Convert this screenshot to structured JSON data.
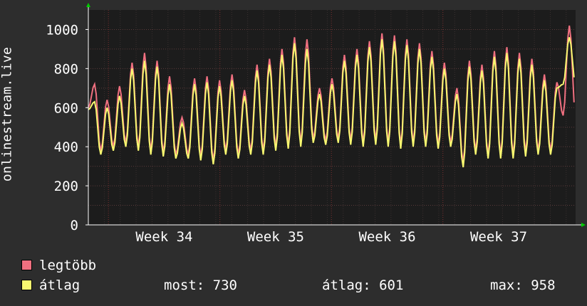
{
  "chart_data": {
    "type": "line",
    "ylabel": "onlinestream.live",
    "ylim": [
      0,
      1100
    ],
    "yticks": [
      0,
      200,
      400,
      600,
      800,
      1000
    ],
    "xlim": [
      0,
      4.37
    ],
    "x_tick_labels": [
      "Week 34",
      "Week 35",
      "Week 36",
      "Week 37"
    ],
    "x_tick_positions": [
      0.68,
      1.68,
      2.68,
      3.68
    ],
    "grid": true,
    "colors": {
      "background": "#2d2d2d",
      "plot_background": "#1c1c1c",
      "grid": "#5a3a3a",
      "axis": "#ffffff",
      "arrow": "#00cc00",
      "max_series": "#f07080",
      "avg_series": "#f8f870"
    },
    "series": [
      {
        "name": "legtöbb",
        "color": "#f07080",
        "daily_peaks": [
          720,
          640,
          710,
          830,
          880,
          840,
          760,
          550,
          750,
          760,
          740,
          770,
          690,
          820,
          850,
          900,
          960,
          950,
          700,
          750,
          870,
          900,
          940,
          980,
          970,
          950,
          930,
          890,
          830,
          700,
          840,
          820,
          890,
          910,
          880,
          850,
          770,
          730,
          1020
        ],
        "daily_troughs": [
          600,
          380,
          400,
          420,
          400,
          380,
          370,
          360,
          360,
          350,
          330,
          380,
          360,
          380,
          380,
          400,
          410,
          420,
          440,
          430,
          440,
          430,
          420,
          430,
          420,
          410,
          420,
          420,
          410,
          420,
          320,
          380,
          360,
          360,
          360,
          370,
          380,
          380,
          560
        ]
      },
      {
        "name": "átlag",
        "color": "#f8f870",
        "daily_peaks": [
          630,
          600,
          660,
          800,
          840,
          810,
          720,
          520,
          720,
          730,
          710,
          740,
          660,
          790,
          820,
          870,
          930,
          900,
          670,
          720,
          840,
          870,
          910,
          950,
          940,
          920,
          900,
          860,
          800,
          670,
          810,
          790,
          860,
          880,
          850,
          820,
          740,
          700,
          960
        ],
        "daily_troughs": [
          590,
          360,
          380,
          400,
          380,
          360,
          350,
          340,
          340,
          330,
          310,
          360,
          340,
          360,
          360,
          380,
          390,
          400,
          420,
          410,
          420,
          410,
          400,
          410,
          400,
          390,
          400,
          400,
          390,
          400,
          295,
          360,
          340,
          340,
          340,
          350,
          360,
          360,
          720
        ]
      }
    ]
  },
  "legend": [
    {
      "label": "legtöbb",
      "color": "#f07080"
    },
    {
      "label": "átlag",
      "color": "#f8f870"
    }
  ],
  "stats": {
    "current": "most: 730",
    "average": "átlag: 601",
    "max": "max: 958"
  }
}
